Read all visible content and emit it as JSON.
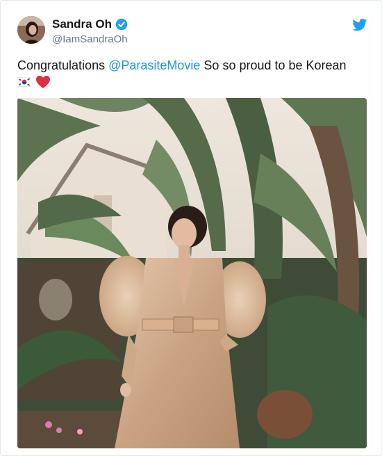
{
  "author": {
    "display_name": "Sandra Oh",
    "handle": "@IamSandraOh"
  },
  "tweet": {
    "text_before": "Congratulations ",
    "mention": "@ParasiteMovie",
    "text_after": " So so proud to be Korean"
  },
  "icons": {
    "verified": "verified-badge-icon",
    "logo": "twitter-bird-icon",
    "flag": "south-korea-flag-emoji",
    "heart": "red-heart-emoji"
  },
  "colors": {
    "brand": "#1da1f2",
    "mention": "#1b95e0",
    "handle": "#657786"
  }
}
